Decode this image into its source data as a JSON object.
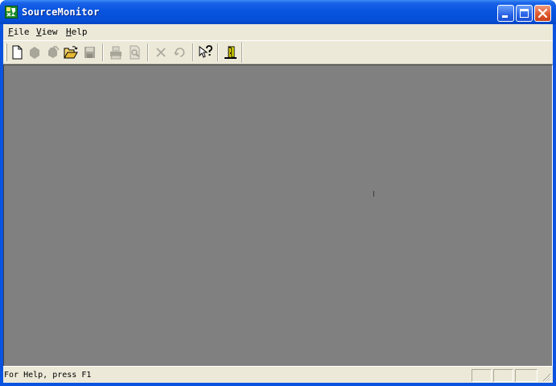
{
  "window": {
    "title": "SourceMonitor",
    "icon": "sourcemonitor-app-icon",
    "controls": [
      "minimize-icon",
      "maximize-icon",
      "close-icon"
    ]
  },
  "menubar": {
    "items": [
      {
        "label": "File",
        "mnemonic": "F",
        "rest": "ile"
      },
      {
        "label": "View",
        "mnemonic": "V",
        "rest": "iew"
      },
      {
        "label": "Help",
        "mnemonic": "H",
        "rest": "elp"
      }
    ]
  },
  "toolbar": {
    "buttons": [
      {
        "name": "new-icon",
        "enabled": true
      },
      {
        "name": "checkpoint-icon",
        "enabled": false
      },
      {
        "name": "checkpoints-icon",
        "enabled": false
      },
      {
        "name": "open-folder-icon",
        "enabled": true
      },
      {
        "name": "save-icon",
        "enabled": false
      },
      {
        "name": "print-icon",
        "enabled": false
      },
      {
        "name": "print-preview-icon",
        "enabled": false
      },
      {
        "name": "delete-icon",
        "enabled": false
      },
      {
        "name": "refresh-icon",
        "enabled": false
      },
      {
        "name": "context-help-icon",
        "enabled": true
      },
      {
        "name": "exit-door-icon",
        "enabled": true
      }
    ]
  },
  "statusbar": {
    "text": "For Help, press F1"
  },
  "colors": {
    "titlebar": "#0754e0",
    "chrome": "#ece9d8",
    "workspace": "#808080",
    "close_button": "#e05a2e"
  }
}
